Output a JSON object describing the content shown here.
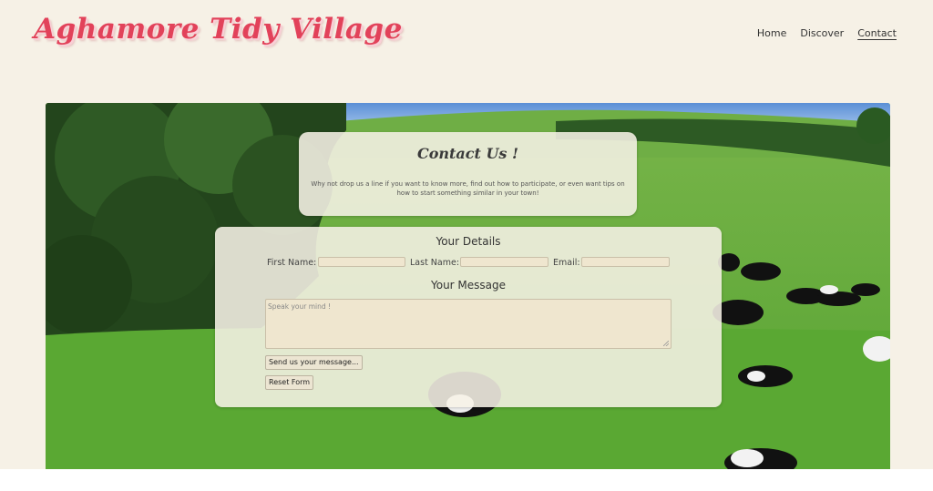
{
  "site": {
    "logo": "Aghamore Tidy Village"
  },
  "nav": {
    "items": [
      {
        "label": "Home",
        "active": false
      },
      {
        "label": "Discover",
        "active": false
      },
      {
        "label": "Contact",
        "active": true
      }
    ]
  },
  "contact": {
    "title": "Contact Us !",
    "text": "Why not drop us a line if you want to know more, find out how to participate, or even want tips on how to start something similar in your town!"
  },
  "form": {
    "details_heading": "Your Details",
    "first_name_label": "First Name:",
    "last_name_label": "Last Name:",
    "email_label": "Email:",
    "first_name_value": "",
    "last_name_value": "",
    "email_value": "",
    "message_heading": "Your Message",
    "message_placeholder": "Speak your mind !",
    "submit_label": "Send us your message...",
    "reset_label": "Reset Form"
  },
  "colors": {
    "logo": "#e2425a",
    "background": "#f6f1e6",
    "panel": "#f6f1e6"
  }
}
